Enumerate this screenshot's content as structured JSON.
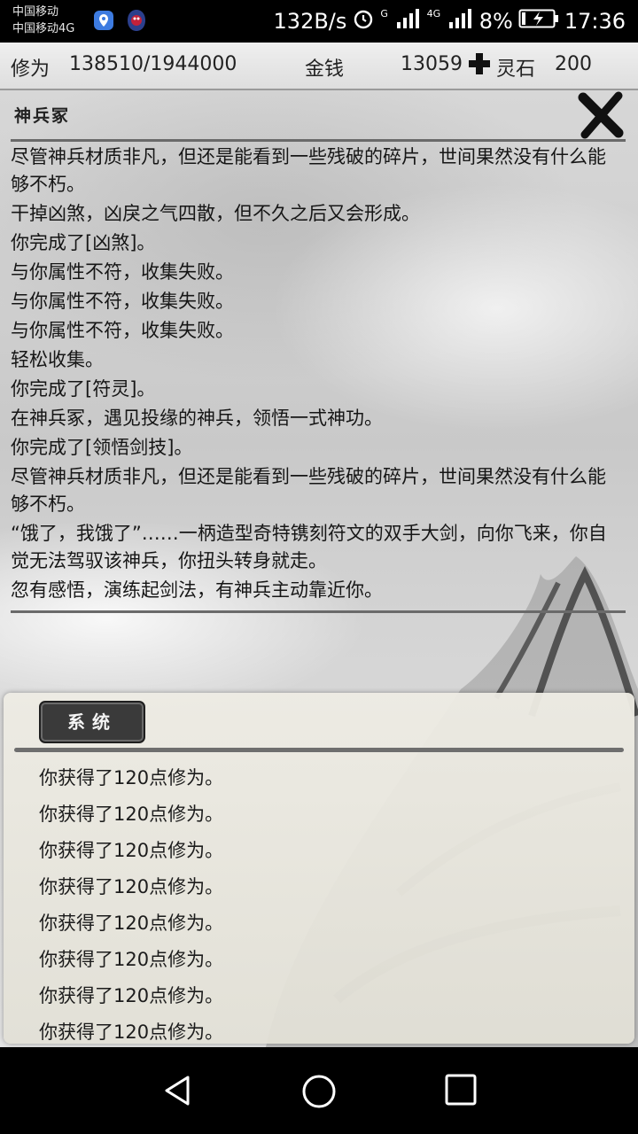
{
  "status_bar": {
    "carrier_1": "中国移动",
    "carrier_2": "中国移动4G",
    "net_speed": "132B/s",
    "signal_1_label": "G",
    "signal_2_label": "4G",
    "battery": "8%",
    "time": "17:36"
  },
  "stats": {
    "cultivation_label": "修为",
    "cultivation_value": "138510/1944000",
    "money_label": "金钱",
    "money_value": "13059",
    "spirit_stone_label": "灵石",
    "spirit_stone_value": "200"
  },
  "panel": {
    "title": "神兵冢",
    "log": [
      "尽管神兵材质非凡，但还是能看到一些残破的碎片，世间果然没有什么能够不朽。",
      "干掉凶煞，凶戾之气四散，但不久之后又会形成。",
      "你完成了[凶煞]。",
      "与你属性不符，收集失败。",
      "与你属性不符，收集失败。",
      "与你属性不符，收集失败。",
      "轻松收集。",
      "你完成了[符灵]。",
      "在神兵冢，遇见投缘的神兵，领悟一式神功。",
      "你完成了[领悟剑技]。",
      "尽管神兵材质非凡，但还是能看到一些残破的碎片，世间果然没有什么能够不朽。",
      "“饿了，我饿了”……一柄造型奇特镌刻符文的双手大剑，向你飞来，你自觉无法驾驭该神兵，你扭头转身就走。",
      "忽有感悟，演练起剑法，有神兵主动靠近你。",
      "尽管神兵材质非凡，但还是能看到一些残破的碎片，世间果然"
    ]
  },
  "system": {
    "tab_label": "系统",
    "messages": [
      "你获得了120点修为。",
      "你获得了120点修为。",
      "你获得了120点修为。",
      "你获得了120点修为。",
      "你获得了120点修为。",
      "你获得了120点修为。",
      "你获得了120点修为。",
      "你获得了120点修为。"
    ]
  }
}
